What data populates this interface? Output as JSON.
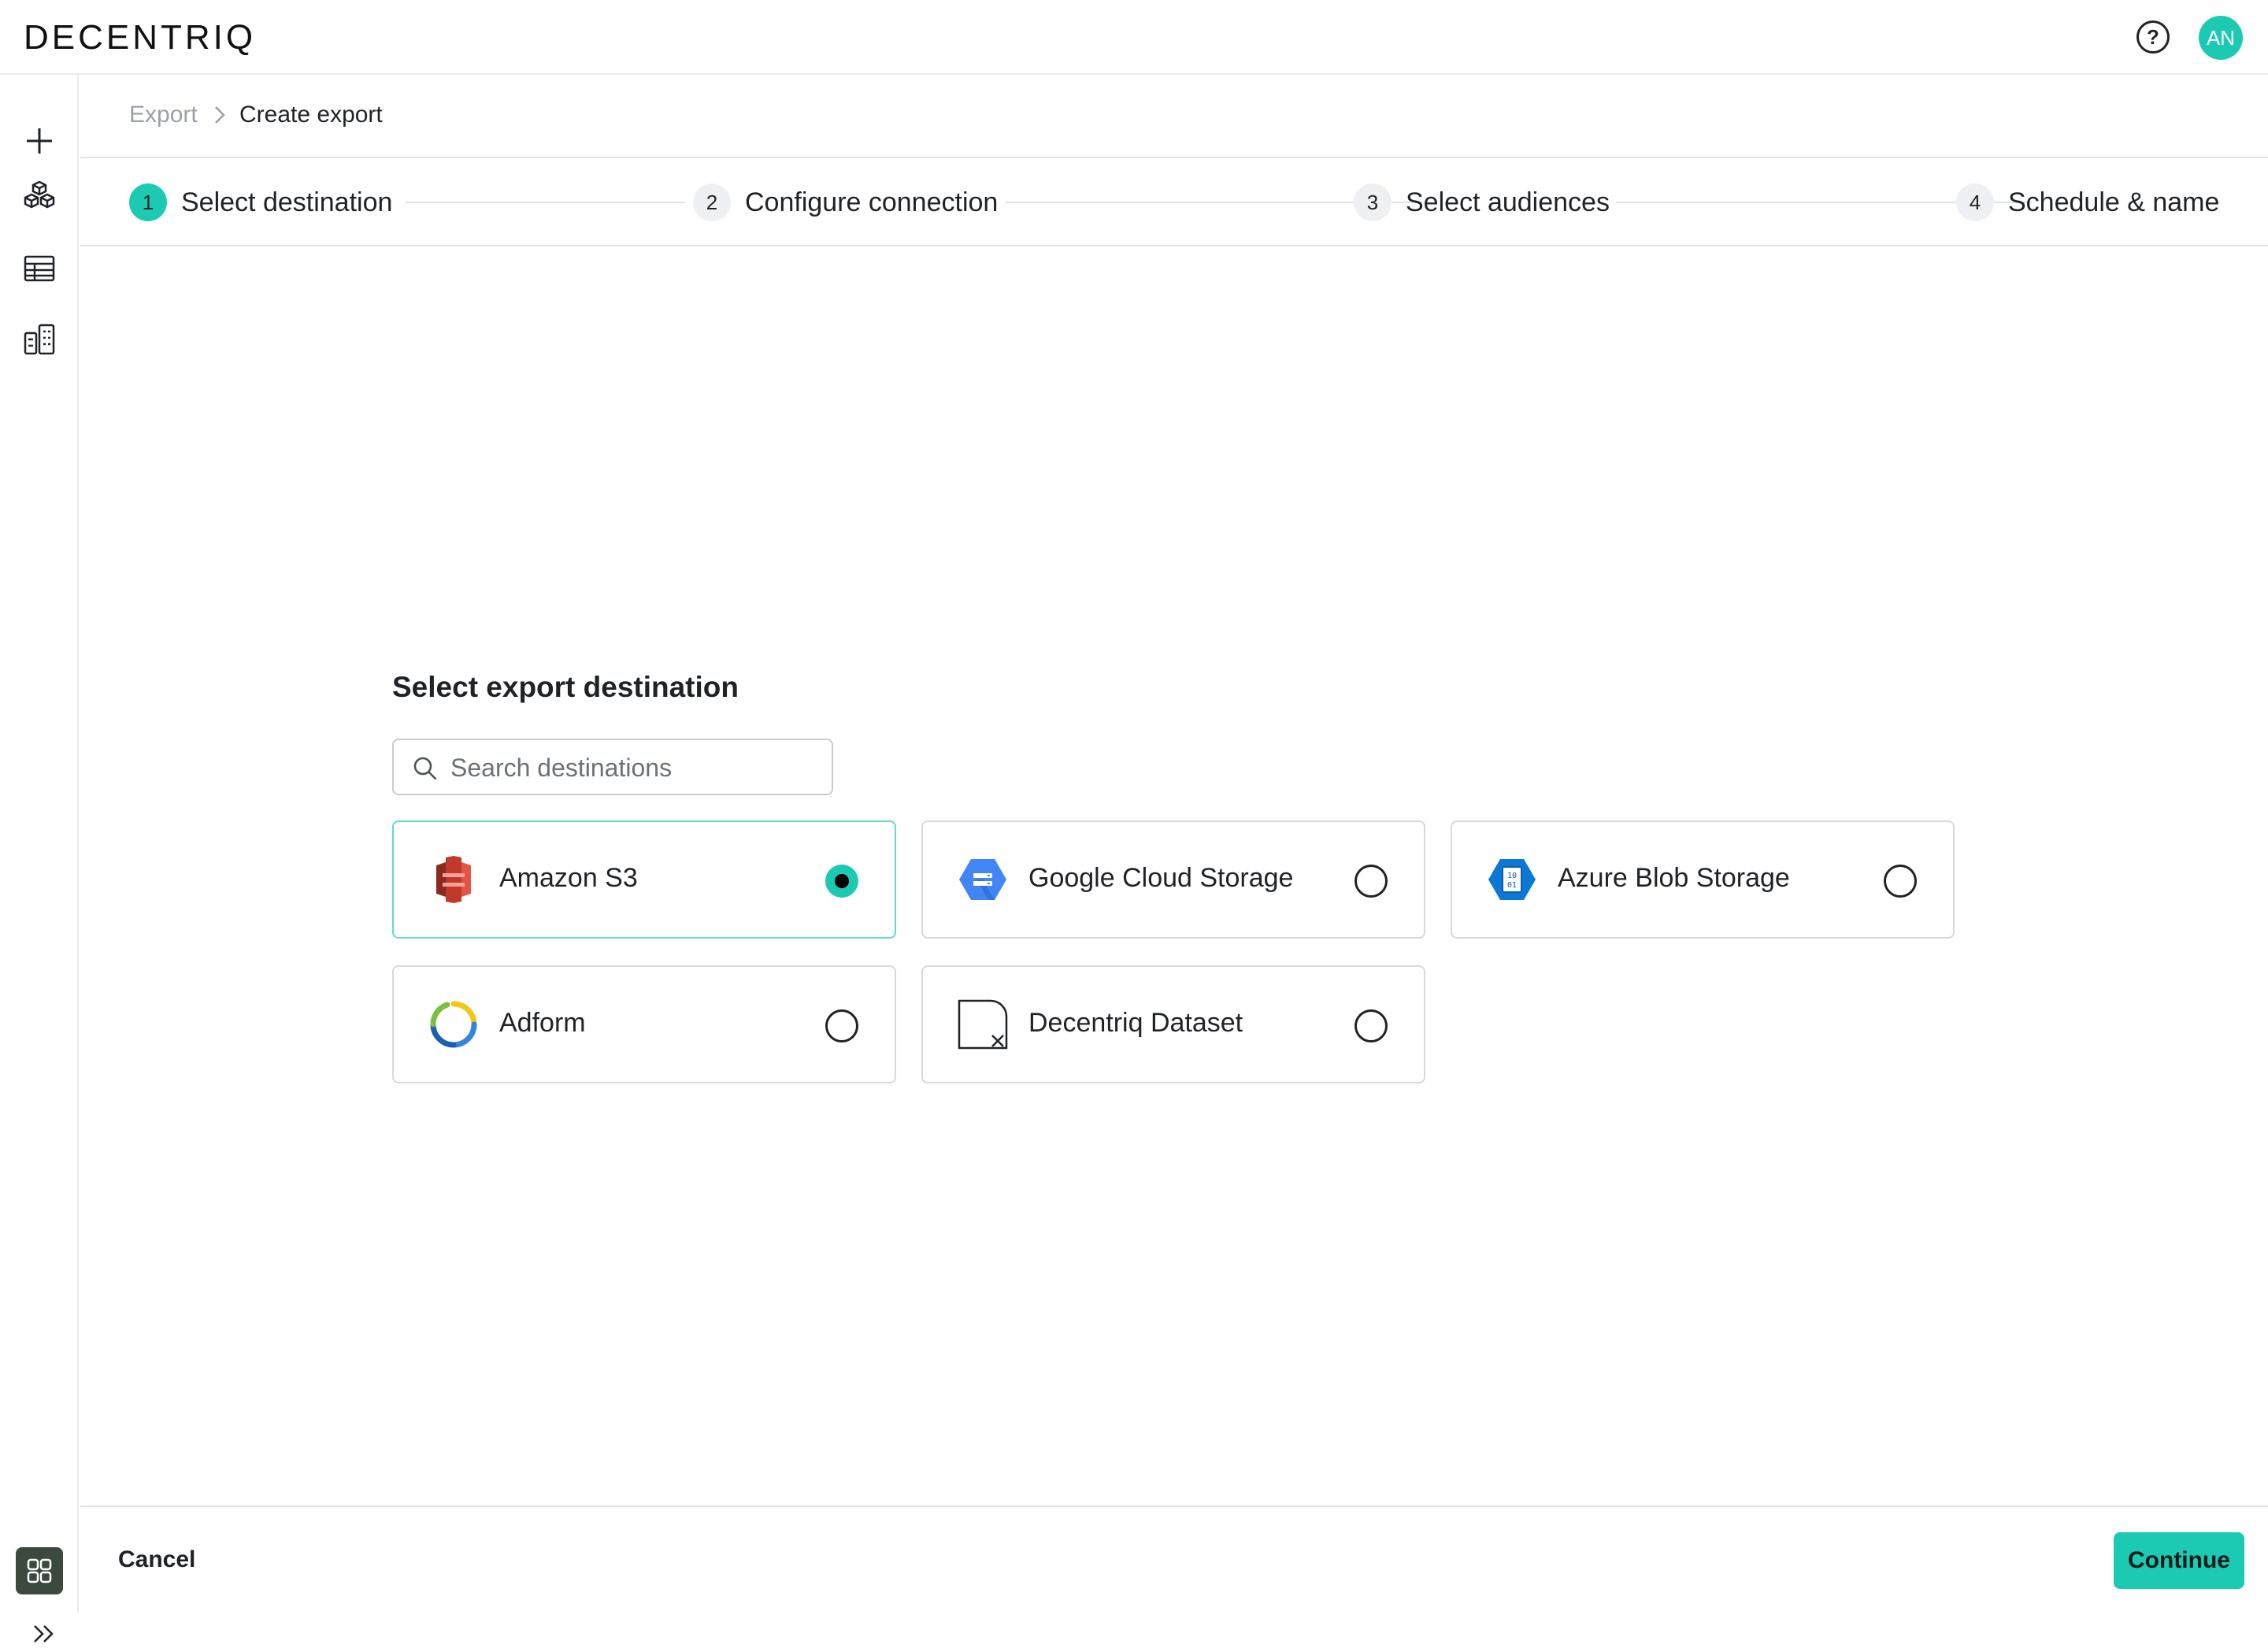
{
  "app": {
    "logo_text": "DECENTRIQ",
    "avatar_initials": "AN",
    "help_icon": "question-circle-icon"
  },
  "sidebar": {
    "items": [
      {
        "icon": "plus-icon"
      },
      {
        "icon": "cubes-icon"
      },
      {
        "icon": "table-icon"
      },
      {
        "icon": "building-icon"
      }
    ],
    "bottom_icon": "grid-app-icon",
    "expand_icon": "double-chevron-right-icon"
  },
  "breadcrumb": {
    "parent": "Export",
    "current": "Create export"
  },
  "stepper": {
    "steps": [
      {
        "number": "1",
        "label": "Select destination",
        "active": true
      },
      {
        "number": "2",
        "label": "Configure connection",
        "active": false
      },
      {
        "number": "3",
        "label": "Select audiences",
        "active": false
      },
      {
        "number": "4",
        "label": "Schedule & name",
        "active": false
      }
    ]
  },
  "main": {
    "heading": "Select export destination",
    "search": {
      "placeholder": "Search destinations",
      "value": ""
    },
    "destinations": [
      {
        "label": "Amazon S3",
        "icon": "amazon-s3-icon",
        "selected": true
      },
      {
        "label": "Google Cloud Storage",
        "icon": "google-cloud-storage-icon",
        "selected": false
      },
      {
        "label": "Azure Blob Storage",
        "icon": "azure-blob-storage-icon",
        "selected": false
      },
      {
        "label": "Adform",
        "icon": "adform-icon",
        "selected": false
      },
      {
        "label": "Decentriq Dataset",
        "icon": "decentriq-dataset-icon",
        "selected": false
      }
    ]
  },
  "footer": {
    "cancel_label": "Cancel",
    "continue_label": "Continue"
  },
  "colors": {
    "accent": "#1ccab3",
    "selected_border": "#62dcc9",
    "border": "#d6d9dd"
  }
}
